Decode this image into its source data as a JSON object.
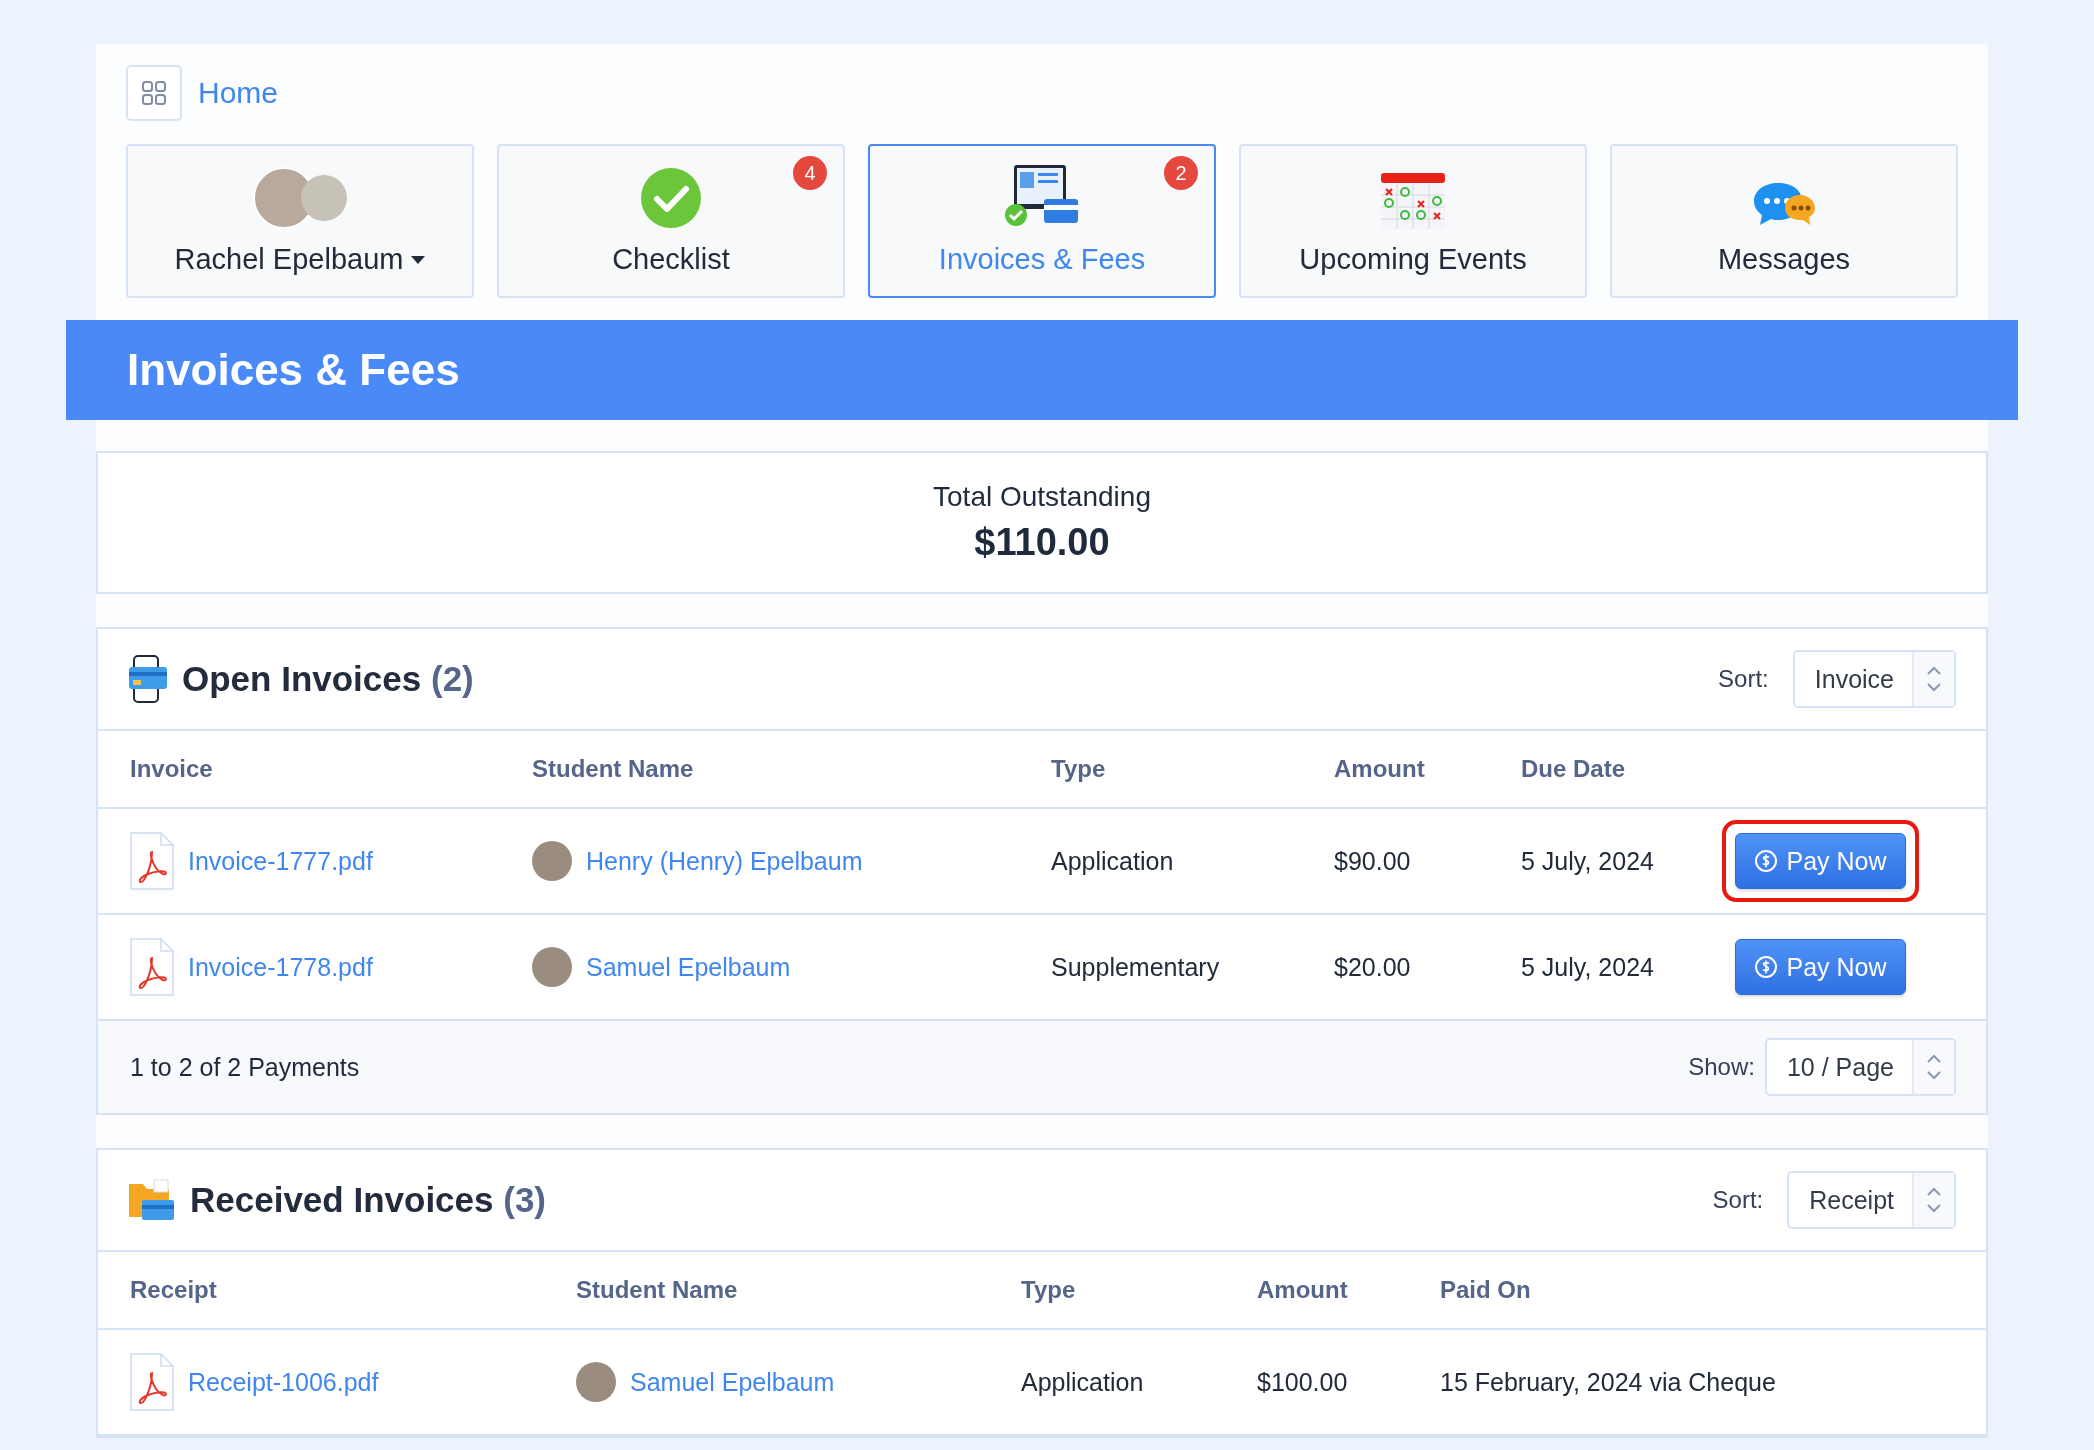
{
  "breadcrumb": {
    "label": "Home"
  },
  "tiles": [
    {
      "kind": "profile",
      "label": "Rachel Epelbaum",
      "dropdown": true,
      "selected": false
    },
    {
      "kind": "checklist",
      "label": "Checklist",
      "badge": "4",
      "selected": false
    },
    {
      "kind": "invoices",
      "label": "Invoices & Fees",
      "badge": "2",
      "selected": true
    },
    {
      "kind": "events",
      "label": "Upcoming Events",
      "selected": false
    },
    {
      "kind": "messages",
      "label": "Messages",
      "selected": false
    }
  ],
  "page_title": "Invoices & Fees",
  "total": {
    "label": "Total Outstanding",
    "amount": "$110.00"
  },
  "sections": [
    {
      "kind": "open",
      "title": "Open Invoices",
      "count": "(2)",
      "sort_label": "Sort:",
      "sort_value": "Invoice",
      "columns": [
        "Invoice",
        "Student Name",
        "Type",
        "Amount",
        "Due Date"
      ],
      "rows": [
        {
          "file": "Invoice-1777.pdf",
          "student": "Henry (Henry) Epelbaum",
          "type": "Application",
          "amount": "$90.00",
          "date": "5 July, 2024",
          "action": "Pay Now",
          "highlighted": true
        },
        {
          "file": "Invoice-1778.pdf",
          "student": "Samuel Epelbaum",
          "type": "Supplementary",
          "amount": "$20.00",
          "date": "5 July, 2024",
          "action": "Pay Now",
          "highlighted": false
        }
      ],
      "footer": {
        "summary": "1 to 2 of 2 Payments",
        "show_label": "Show:",
        "show_value": "10 / Page"
      }
    },
    {
      "kind": "received",
      "title": "Received Invoices",
      "count": "(3)",
      "sort_label": "Sort:",
      "sort_value": "Receipt",
      "columns": [
        "Receipt",
        "Student Name",
        "Type",
        "Amount",
        "Paid On"
      ],
      "rows": [
        {
          "file": "Receipt-1006.pdf",
          "student": "Samuel Epelbaum",
          "type": "Application",
          "amount": "$100.00",
          "date": "15 February, 2024 via Cheque"
        }
      ]
    }
  ]
}
